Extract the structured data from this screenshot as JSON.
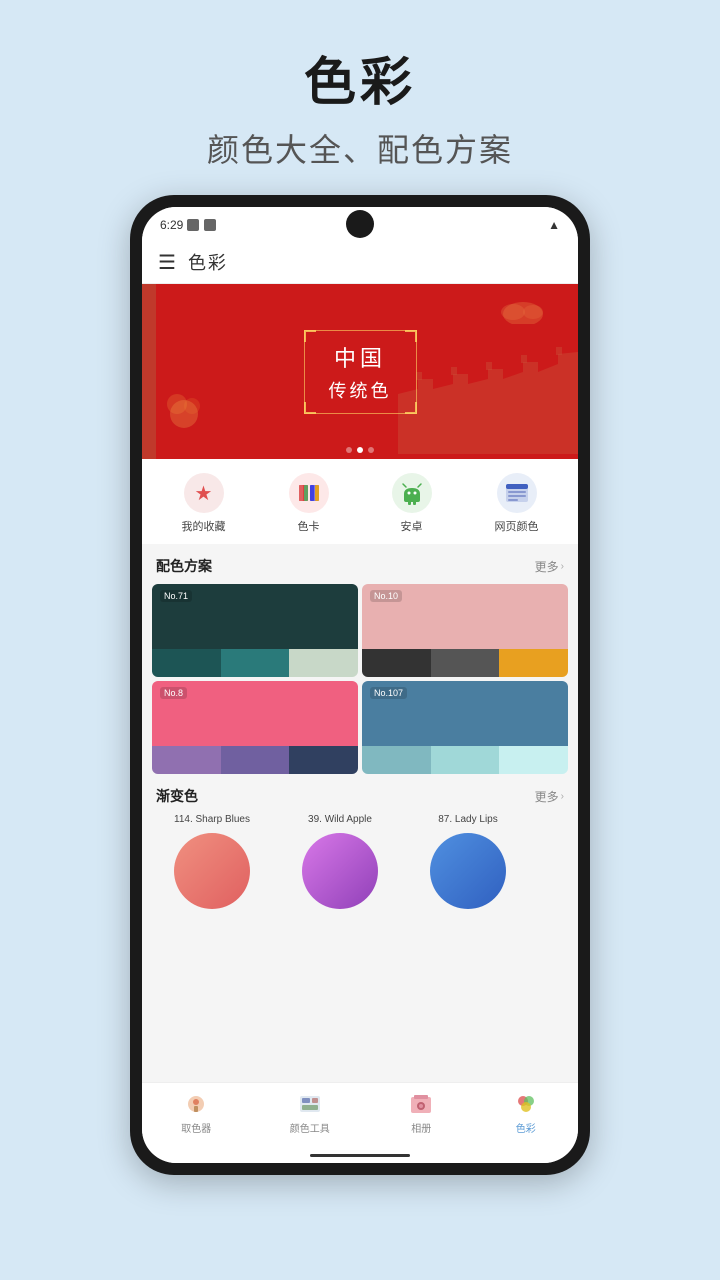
{
  "page": {
    "title": "色彩",
    "subtitle": "颜色大全、配色方案"
  },
  "status_bar": {
    "time": "6:29",
    "signal": "▲"
  },
  "app_header": {
    "title": "色彩"
  },
  "banner": {
    "main_text": "中国",
    "sub_text": "传统色"
  },
  "quick_nav": {
    "items": [
      {
        "label": "我的收藏",
        "icon": "⭐",
        "color": "#f0a0a0"
      },
      {
        "label": "色卡",
        "icon": "🎨",
        "color": "#f5c6c6"
      },
      {
        "label": "安卓",
        "icon": "🤖",
        "color": "#a8d8a8"
      },
      {
        "label": "网页颜色",
        "icon": "📋",
        "color": "#a0b8e8"
      }
    ]
  },
  "palettes_section": {
    "title": "配色方案",
    "more": "更多",
    "items": [
      {
        "id": "No.71",
        "main_color": "#1d3d3d",
        "swatches": [
          "#1d5555",
          "#2a7a7a",
          "#c8d8c8"
        ]
      },
      {
        "id": "No.10",
        "main_color": "#e8b0b0",
        "swatches": [
          "#333333",
          "#555555",
          "#e8a020"
        ]
      },
      {
        "id": "No.8",
        "main_color": "#f06080",
        "swatches": [
          "#9070b0",
          "#7060a0",
          "#304060"
        ]
      },
      {
        "id": "No.107",
        "main_color": "#4a7ea0",
        "swatches": [
          "#80b8c0",
          "#a0d8d8",
          "#c8f0f0"
        ]
      }
    ]
  },
  "gradients_section": {
    "title": "渐变色",
    "more": "更多",
    "items": [
      {
        "name": "114. Sharp Blues",
        "color_start": "#f08070",
        "color_end": "#e06060"
      },
      {
        "name": "39. Wild Apple",
        "color_start": "#d070e0",
        "color_end": "#a050c0"
      },
      {
        "name": "87. Lady Lips",
        "color_start": "#4090e0",
        "color_end": "#3070c0"
      }
    ]
  },
  "bottom_nav": {
    "items": [
      {
        "label": "取色器",
        "icon": "🎨",
        "active": false
      },
      {
        "label": "颜色工具",
        "icon": "🗂",
        "active": false
      },
      {
        "label": "相册",
        "icon": "🖼",
        "active": false
      },
      {
        "label": "色彩",
        "icon": "🍎",
        "active": true
      }
    ]
  }
}
